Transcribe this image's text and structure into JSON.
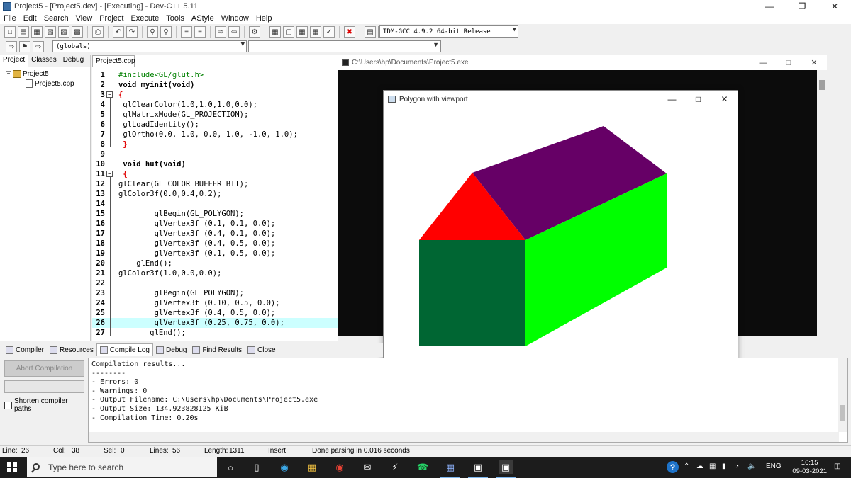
{
  "ide": {
    "title": "Project5 - [Project5.dev] - [Executing] - Dev-C++ 5.11",
    "menu": [
      "File",
      "Edit",
      "Search",
      "View",
      "Project",
      "Execute",
      "Tools",
      "AStyle",
      "Window",
      "Help"
    ],
    "compiler": "TDM-GCC 4.9.2 64-bit Release",
    "globals": "(globals)",
    "left_tabs": [
      "Project",
      "Classes",
      "Debug"
    ],
    "tree": {
      "project": "Project5",
      "file": "Project5.cpp"
    },
    "editor_tab": "Project5.cpp"
  },
  "code_lines": [
    {
      "n": "1",
      "text": "#include<GL/glut.h>"
    },
    {
      "n": "2",
      "text": "void myinit(void)"
    },
    {
      "n": "3",
      "text": "{"
    },
    {
      "n": "4",
      "text": " glClearColor(1.0,1.0,1.0,0.0);"
    },
    {
      "n": "5",
      "text": " glMatrixMode(GL_PROJECTION);"
    },
    {
      "n": "6",
      "text": " glLoadIdentity();"
    },
    {
      "n": "7",
      "text": " glOrtho(0.0, 1.0, 0.0, 1.0, -1.0, 1.0);"
    },
    {
      "n": "8",
      "text": " }"
    },
    {
      "n": "9",
      "text": ""
    },
    {
      "n": "10",
      "text": " void hut(void)"
    },
    {
      "n": "11",
      "text": " {"
    },
    {
      "n": "12",
      "text": "glClear(GL_COLOR_BUFFER_BIT);"
    },
    {
      "n": "13",
      "text": "glColor3f(0.0,0.4,0.2);"
    },
    {
      "n": "14",
      "text": ""
    },
    {
      "n": "15",
      "text": "        glBegin(GL_POLYGON);"
    },
    {
      "n": "16",
      "text": "        glVertex3f (0.1, 0.1, 0.0);"
    },
    {
      "n": "17",
      "text": "        glVertex3f (0.4, 0.1, 0.0);"
    },
    {
      "n": "18",
      "text": "        glVertex3f (0.4, 0.5, 0.0);"
    },
    {
      "n": "19",
      "text": "        glVertex3f (0.1, 0.5, 0.0);"
    },
    {
      "n": "20",
      "text": "    glEnd();"
    },
    {
      "n": "21",
      "text": "glColor3f(1.0,0.0,0.0);"
    },
    {
      "n": "22",
      "text": ""
    },
    {
      "n": "23",
      "text": "        glBegin(GL_POLYGON);"
    },
    {
      "n": "24",
      "text": "        glVertex3f (0.10, 0.5, 0.0);"
    },
    {
      "n": "25",
      "text": "        glVertex3f (0.4, 0.5, 0.0);"
    },
    {
      "n": "26",
      "text": "        glVertex3f (0.25, 0.75, 0.0);"
    },
    {
      "n": "27",
      "text": "       glEnd();"
    }
  ],
  "console": {
    "title": "C:\\Users\\hp\\Documents\\Project5.exe"
  },
  "glwindow": {
    "title": "Polygon with viewport"
  },
  "bottom_tabs": [
    "Compiler",
    "Resources",
    "Compile Log",
    "Debug",
    "Find Results",
    "Close"
  ],
  "compile": {
    "abort_label": "Abort Compilation",
    "shorten_label": "Shorten compiler paths",
    "log": [
      "Compilation results...",
      "--------",
      "- Errors: 0",
      "- Warnings: 0",
      "- Output Filename: C:\\Users\\hp\\Documents\\Project5.exe",
      "- Output Size: 134.923828125 KiB",
      "- Compilation Time: 0.20s"
    ]
  },
  "status": {
    "line_label": "Line:",
    "line": "26",
    "col_label": "Col:",
    "col": "38",
    "sel_label": "Sel:",
    "sel": "0",
    "lines_label": "Lines:",
    "lines": "56",
    "length_label": "Length:",
    "length": "1311",
    "mode": "Insert",
    "message": "Done parsing in 0.016 seconds"
  },
  "taskbar": {
    "search_placeholder": "Type here to search",
    "language": "ENG",
    "time": "16:15",
    "date": "09-03-2021"
  },
  "colors": {
    "front_wall": "#006633",
    "side_wall": "#00ff00",
    "roof_gable": "#ff0000",
    "roof": "#660066",
    "highlight_line": "#ccffff"
  }
}
